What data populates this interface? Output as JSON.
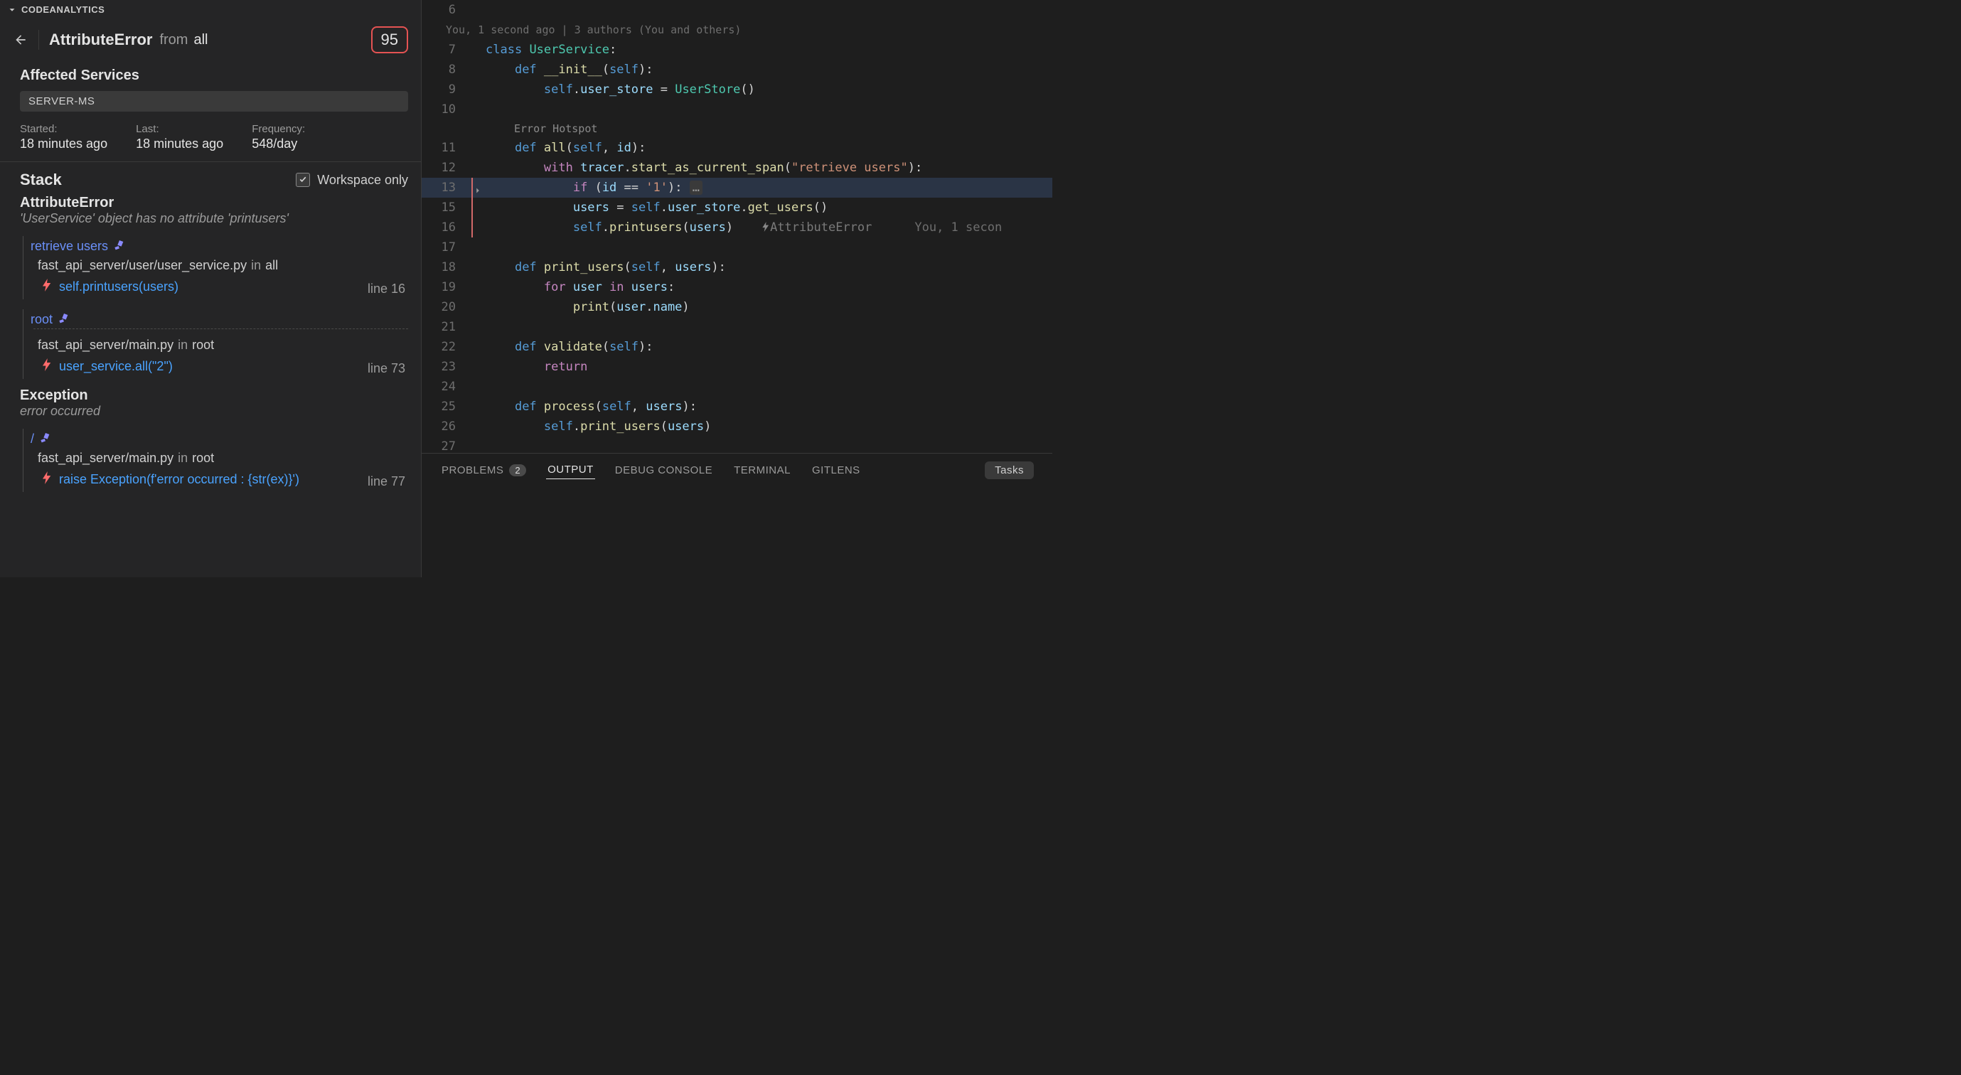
{
  "panel": {
    "title": "CODEANALYTICS",
    "error_title": "AttributeError",
    "from_label": "from",
    "from_value": "all",
    "count": "95",
    "affected_h": "Affected Services",
    "service_chip": "SERVER-MS",
    "meta": {
      "started_label": "Started:",
      "started_value": "18 minutes ago",
      "last_label": "Last:",
      "last_value": "18 minutes ago",
      "freq_label": "Frequency:",
      "freq_value": "548/day"
    },
    "stack_h": "Stack",
    "workspace_label": "Workspace only",
    "error_name": "AttributeError",
    "error_msg": "'UserService' object has no attribute 'printusers'",
    "frames": [
      {
        "span": "retrieve users",
        "src_path": "fast_api_server/user/user_service.py",
        "in": "in",
        "src_fn": "all",
        "code": "self.printusers(users)",
        "line": "line 16"
      },
      {
        "span": "root",
        "src_path": "fast_api_server/main.py",
        "in": "in",
        "src_fn": "root",
        "code": "user_service.all(\"2\")",
        "line": "line 73"
      }
    ],
    "exception_h": "Exception",
    "exception_msg": "error occurred",
    "exc_frame": {
      "span": "/",
      "src_path": "fast_api_server/main.py",
      "in": "in",
      "src_fn": "root",
      "code": "raise Exception(f'error occurred : {str(ex)}')",
      "line": "line 77"
    }
  },
  "editor": {
    "blame_top": "You, 1 second ago | 3 authors (You and others)",
    "hotspot": "Error Hotspot",
    "fold_dots": "…",
    "inline_hint": "AttributeError",
    "inline_blame": "You, 1 secon",
    "lines": {
      "6": "",
      "7": "class UserService:",
      "8": "    def __init__(self):",
      "9": "        self.user_store = UserStore()",
      "10": "",
      "11": "    def all(self, id):",
      "12": "        with tracer.start_as_current_span(\"retrieve users\"):",
      "13": "            if (id == '1'):",
      "15": "            users = self.user_store.get_users()",
      "16": "            self.printusers(users)",
      "17": "",
      "18": "    def print_users(self, users):",
      "19": "        for user in users:",
      "20": "            print(user.name)",
      "21": "",
      "22": "    def validate(self):",
      "23": "        return",
      "24": "",
      "25": "    def process(self, users):",
      "26": "        self.print_users(users)",
      "27": ""
    }
  },
  "bottom": {
    "problems": "PROBLEMS",
    "problems_count": "2",
    "output": "OUTPUT",
    "debug": "DEBUG CONSOLE",
    "terminal": "TERMINAL",
    "gitlens": "GITLENS",
    "tasks": "Tasks"
  }
}
